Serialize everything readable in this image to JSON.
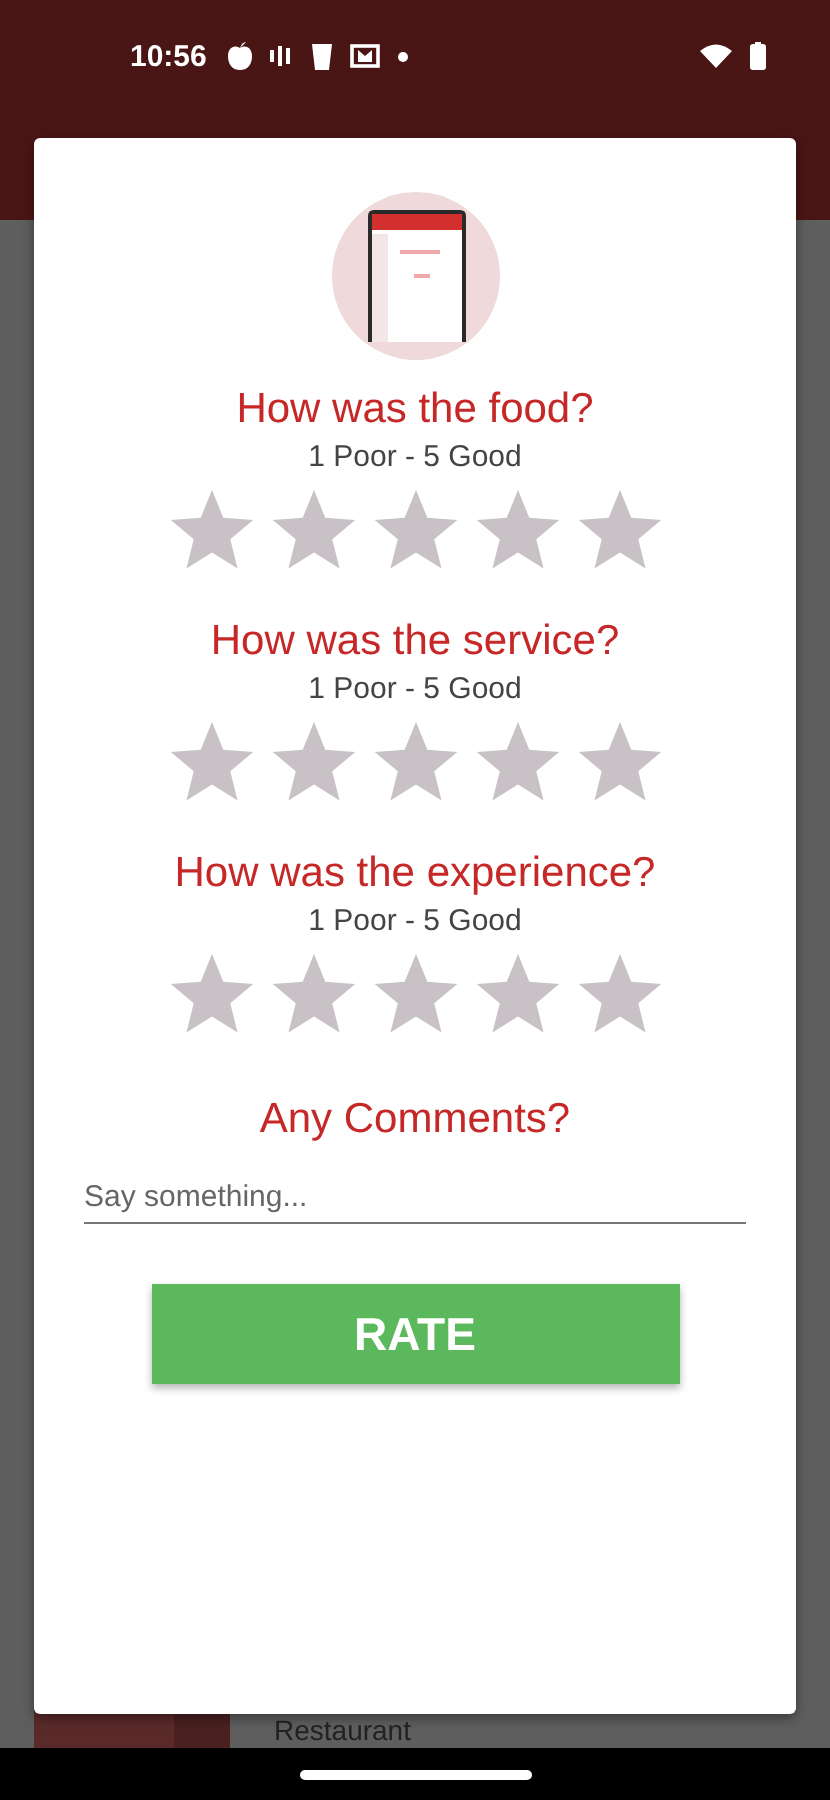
{
  "status_bar": {
    "time": "10:56"
  },
  "background": {
    "restaurant_name": "Restaurant"
  },
  "questions": [
    {
      "title": "How was the food?",
      "scale": "1 Poor - 5 Good",
      "stars": 0
    },
    {
      "title": "How was the service?",
      "scale": "1 Poor - 5 Good",
      "stars": 0
    },
    {
      "title": "How was the experience?",
      "scale": "1 Poor - 5 Good",
      "stars": 0
    }
  ],
  "comments": {
    "title": "Any Comments?",
    "placeholder": "Say something..."
  },
  "rate_button": {
    "label": "RATE"
  }
}
